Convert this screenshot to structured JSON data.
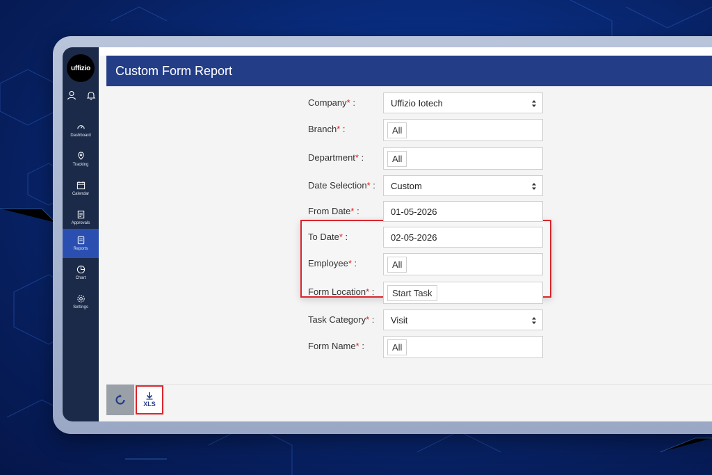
{
  "app": {
    "logo_text": "uffizio"
  },
  "sidebar": {
    "items": [
      {
        "label": "Dashboard",
        "icon": "dashboard-icon"
      },
      {
        "label": "Tracking",
        "icon": "tracking-icon"
      },
      {
        "label": "Calendar",
        "icon": "calendar-icon"
      },
      {
        "label": "Approvals",
        "icon": "approvals-icon"
      },
      {
        "label": "Reports",
        "icon": "reports-icon",
        "active": true
      },
      {
        "label": "Chart",
        "icon": "chart-icon"
      },
      {
        "label": "Settings",
        "icon": "settings-icon"
      }
    ]
  },
  "page": {
    "title": "Custom Form Report"
  },
  "form": {
    "company": {
      "label": "Company",
      "value": "Uffizio Iotech"
    },
    "branch": {
      "label": "Branch",
      "value": "All"
    },
    "department": {
      "label": "Department",
      "value": "All"
    },
    "date_selection": {
      "label": "Date Selection",
      "value": "Custom"
    },
    "from_date": {
      "label": "From Date",
      "value": "01-05-2026"
    },
    "to_date": {
      "label": "To Date",
      "value": "02-05-2026"
    },
    "employee": {
      "label": "Employee",
      "value": "All"
    },
    "form_location": {
      "label": "Form Location",
      "value": "Start Task"
    },
    "task_category": {
      "label": "Task Category",
      "value": "Visit"
    },
    "form_name": {
      "label": "Form Name",
      "value": "All"
    },
    "required_mark": "*",
    "colon": ":"
  },
  "footer": {
    "xls_label": "XLS"
  },
  "colors": {
    "accent": "#233d87",
    "required": "#e02020",
    "highlight": "#d9262c",
    "sidebar_bg": "#1b2a48",
    "active_nav": "#2a4fb0"
  }
}
